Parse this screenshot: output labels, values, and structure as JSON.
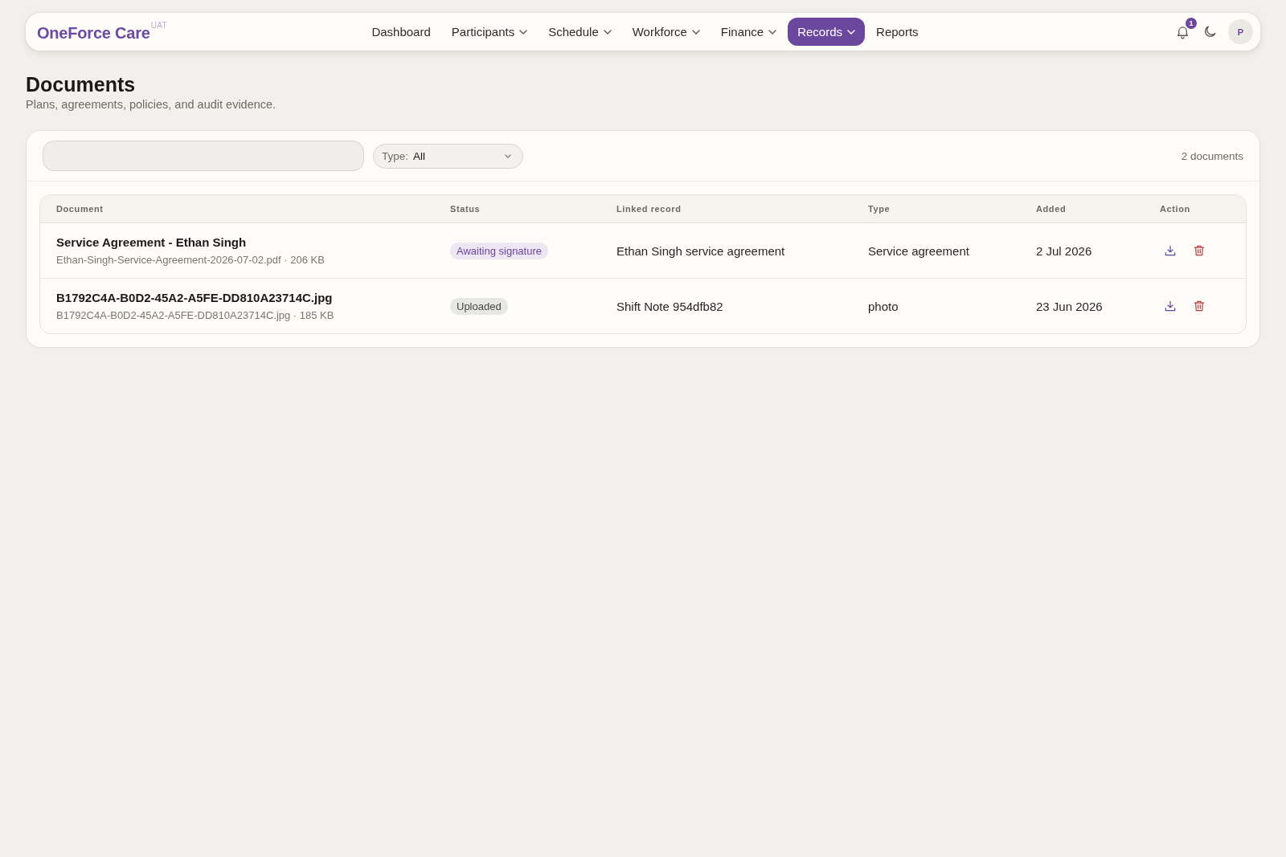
{
  "nav": {
    "logo": "OneForce Care",
    "environment": "UAT",
    "items": [
      {
        "label": "Dashboard",
        "has_menu": false,
        "selected": false
      },
      {
        "label": "Participants",
        "has_menu": true,
        "selected": false
      },
      {
        "label": "Schedule",
        "has_menu": true,
        "selected": false
      },
      {
        "label": "Workforce",
        "has_menu": true,
        "selected": false
      },
      {
        "label": "Finance",
        "has_menu": true,
        "selected": false
      },
      {
        "label": "Records",
        "has_menu": true,
        "selected": true
      },
      {
        "label": "Reports",
        "has_menu": false,
        "selected": false
      }
    ],
    "notification_count": "1",
    "avatar_initial": "P"
  },
  "page": {
    "title": "Documents",
    "subtitle": "Plans, agreements, policies, and audit evidence."
  },
  "toolbar": {
    "type_filter": {
      "label": "Type:",
      "value": "All"
    },
    "count": "2 documents"
  },
  "table": {
    "columns": [
      "Document",
      "Status",
      "Linked record",
      "Type",
      "Added",
      "Action"
    ],
    "rows": [
      {
        "name": "Service Agreement - Ethan Singh",
        "file_info": "Ethan-Singh-Service-Agreement-2026-07-02.pdf · 206 KB",
        "status": {
          "label": "Awaiting signature",
          "color": "#6b46a0"
        },
        "linked_record": "Ethan Singh service agreement",
        "type": "Service agreement",
        "added": "2 Jul 2026"
      },
      {
        "name": "B1792C4A-B0D2-45A2-A5FE-DD810A23714C.jpg",
        "file_info": "B1792C4A-B0D2-45A2-A5FE-DD810A23714C.jpg · 185 KB",
        "status": {
          "label": "Uploaded",
          "color": "#4a4640"
        },
        "linked_record": "Shift Note 954dfb82",
        "type": "photo",
        "added": "23 Jun 2026"
      }
    ]
  }
}
